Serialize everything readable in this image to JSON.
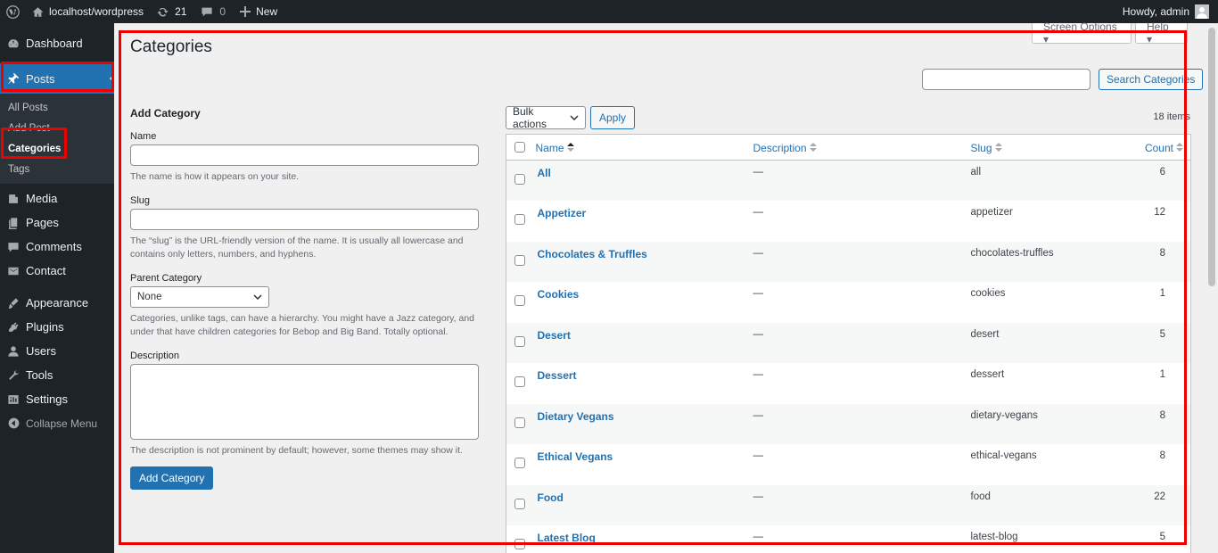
{
  "adminbar": {
    "site_name": "localhost/wordpress",
    "updates_count": "21",
    "comments_count": "0",
    "new_label": "New",
    "greeting": "Howdy, admin"
  },
  "menu": {
    "items_top": [
      {
        "label": "Dashboard",
        "icon": "dashboard-icon"
      }
    ],
    "posts_label": "Posts",
    "posts_sub": [
      {
        "label": "All Posts"
      },
      {
        "label": "Add Post"
      },
      {
        "label": "Categories"
      },
      {
        "label": "Tags"
      }
    ],
    "items_bottom": [
      {
        "label": "Media",
        "icon": "media-icon"
      },
      {
        "label": "Pages",
        "icon": "pages-icon"
      },
      {
        "label": "Comments",
        "icon": "comments-icon"
      },
      {
        "label": "Contact",
        "icon": "contact-icon"
      },
      {
        "label": "Appearance",
        "icon": "appearance-icon"
      },
      {
        "label": "Plugins",
        "icon": "plugins-icon"
      },
      {
        "label": "Users",
        "icon": "users-icon"
      },
      {
        "label": "Tools",
        "icon": "tools-icon"
      },
      {
        "label": "Settings",
        "icon": "settings-icon"
      }
    ],
    "collapse_label": "Collapse Menu"
  },
  "screen_meta": {
    "screen_options": "Screen Options ▾",
    "help": "Help ▾"
  },
  "page": {
    "title": "Categories",
    "search_button": "Search Categories",
    "search_value": ""
  },
  "form": {
    "heading": "Add Category",
    "name_label": "Name",
    "name_value": "",
    "name_help": "The name is how it appears on your site.",
    "slug_label": "Slug",
    "slug_value": "",
    "slug_help": "The “slug” is the URL-friendly version of the name. It is usually all lowercase and contains only letters, numbers, and hyphens.",
    "parent_label": "Parent Category",
    "parent_selected": "None",
    "parent_help": "Categories, unlike tags, can have a hierarchy. You might have a Jazz category, and under that have children categories for Bebop and Big Band. Totally optional.",
    "description_label": "Description",
    "description_help": "The description is not prominent by default; however, some themes may show it.",
    "submit_label": "Add Category"
  },
  "list": {
    "bulk_selected": "Bulk actions",
    "apply_label": "Apply",
    "items_count": "18 items",
    "columns": {
      "name": "Name",
      "description": "Description",
      "slug": "Slug",
      "count": "Count"
    },
    "rows": [
      {
        "name": "All",
        "description": "—",
        "slug": "all",
        "count": "6"
      },
      {
        "name": "Appetizer",
        "description": "—",
        "slug": "appetizer",
        "count": "12"
      },
      {
        "name": "Chocolates & Truffles",
        "description": "—",
        "slug": "chocolates-truffles",
        "count": "8"
      },
      {
        "name": "Cookies",
        "description": "—",
        "slug": "cookies",
        "count": "1"
      },
      {
        "name": "Desert",
        "description": "—",
        "slug": "desert",
        "count": "5"
      },
      {
        "name": "Dessert",
        "description": "—",
        "slug": "dessert",
        "count": "1"
      },
      {
        "name": "Dietary Vegans",
        "description": "—",
        "slug": "dietary-vegans",
        "count": "8"
      },
      {
        "name": "Ethical Vegans",
        "description": "—",
        "slug": "ethical-vegans",
        "count": "8"
      },
      {
        "name": "Food",
        "description": "—",
        "slug": "food",
        "count": "22"
      },
      {
        "name": "Latest Blog",
        "description": "—",
        "slug": "latest-blog",
        "count": "5"
      }
    ]
  },
  "colors": {
    "accent": "#2271b1",
    "admin_bar": "#1d2327",
    "highlight": "#ee0000"
  }
}
